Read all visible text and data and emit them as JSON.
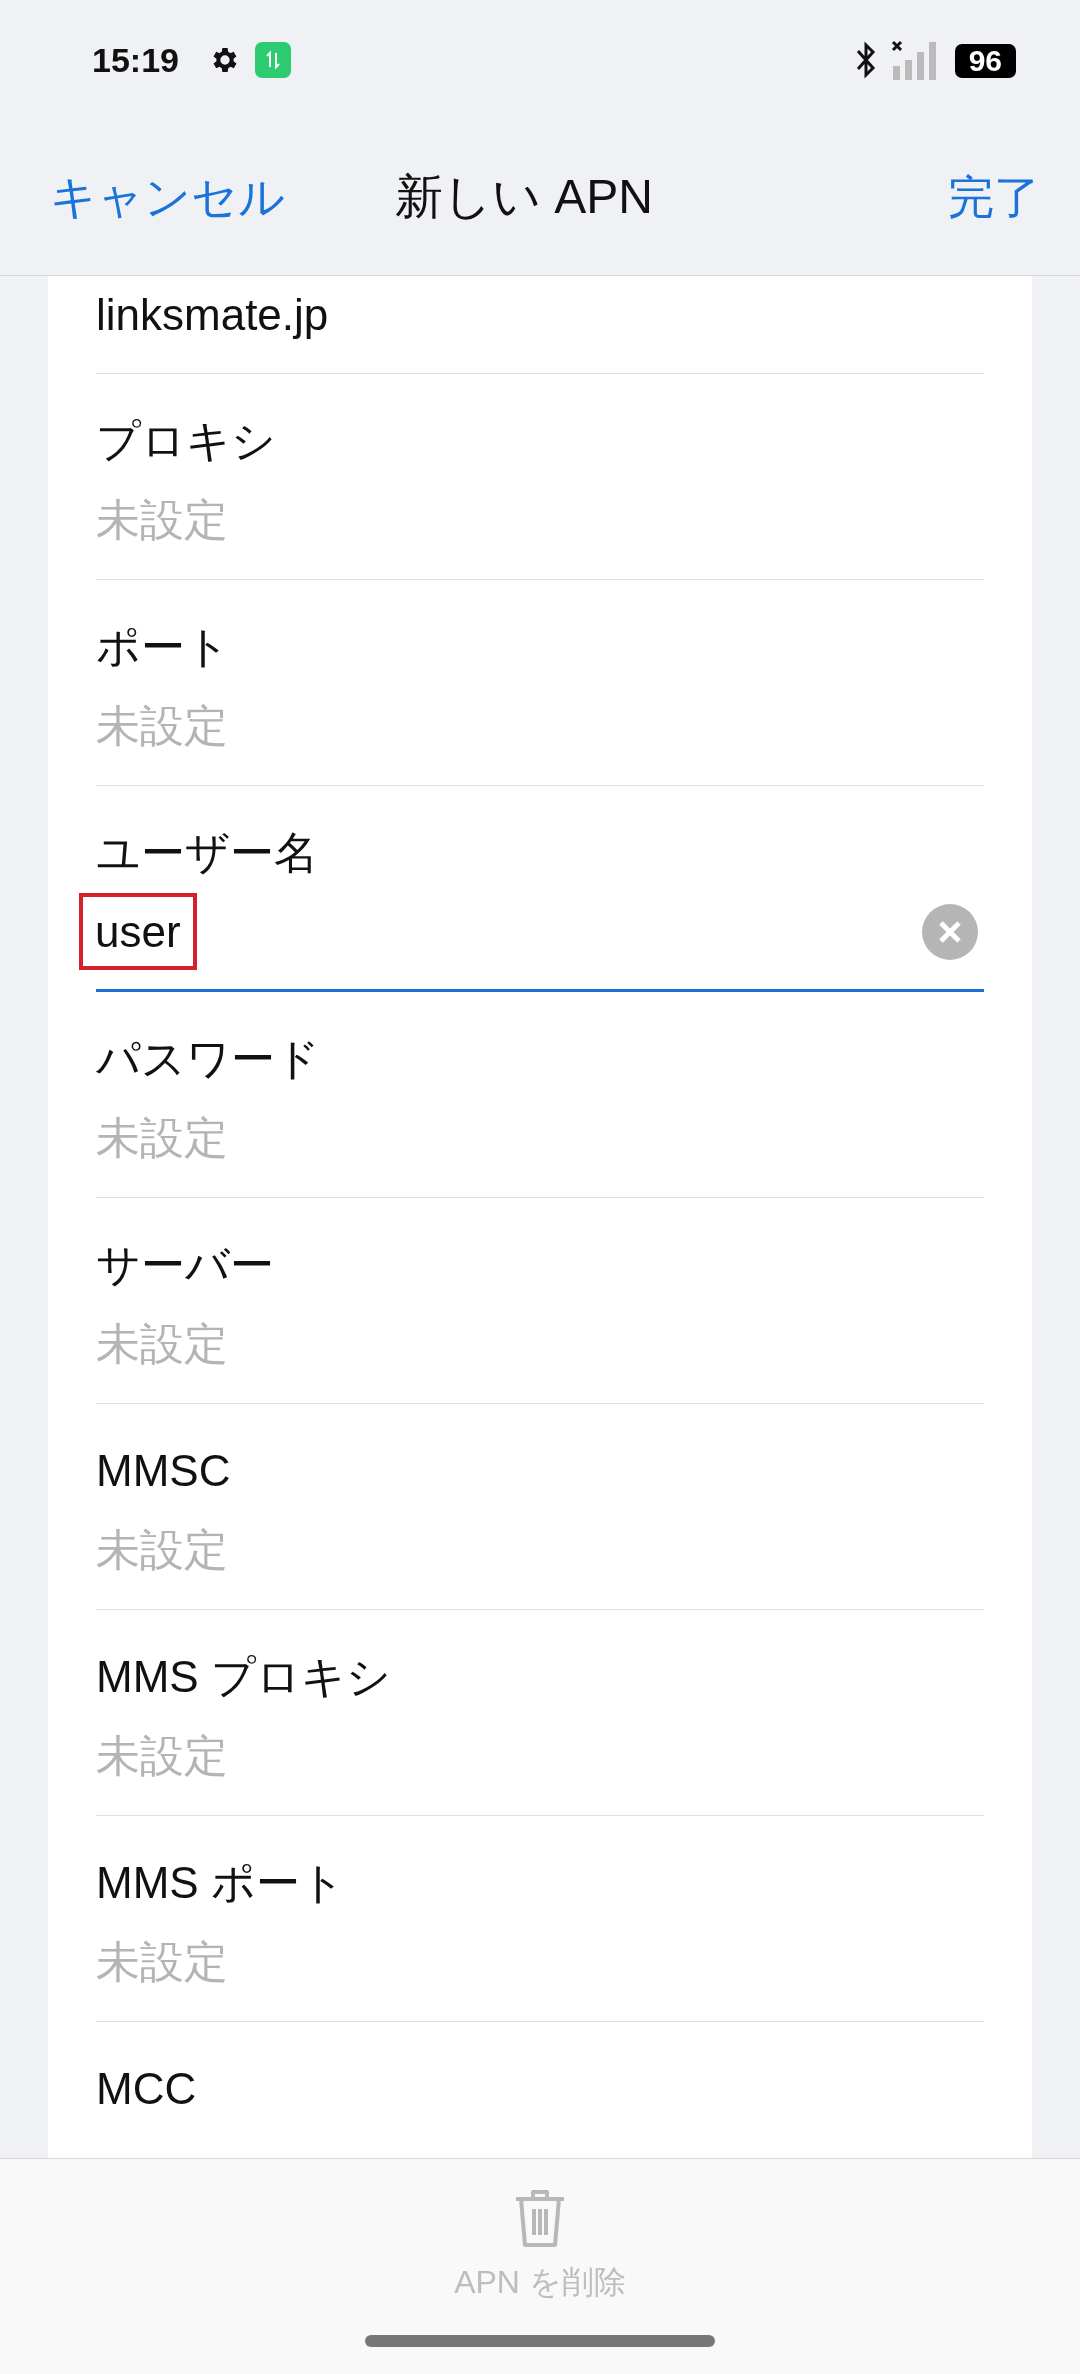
{
  "status_bar": {
    "time": "15:19",
    "battery": "96"
  },
  "header": {
    "cancel": "キャンセル",
    "title": "新しい APN",
    "done": "完了"
  },
  "fields": [
    {
      "value": "linksmate.jp",
      "focused": false
    },
    {
      "label": "プロキシ",
      "placeholder": "未設定",
      "focused": false
    },
    {
      "label": "ポート",
      "placeholder": "未設定",
      "focused": false
    },
    {
      "label": "ユーザー名",
      "value": "user",
      "focused": true,
      "highlighted": true
    },
    {
      "label": "パスワード",
      "placeholder": "未設定",
      "focused": false
    },
    {
      "label": "サーバー",
      "placeholder": "未設定",
      "focused": false
    },
    {
      "label": "MMSC",
      "placeholder": "未設定",
      "focused": false
    },
    {
      "label": "MMS プロキシ",
      "placeholder": "未設定",
      "focused": false
    },
    {
      "label": "MMS ポート",
      "placeholder": "未設定",
      "focused": false
    },
    {
      "label": "MCC",
      "focused": false
    }
  ],
  "bottom_bar": {
    "delete_label": "APN を削除"
  }
}
